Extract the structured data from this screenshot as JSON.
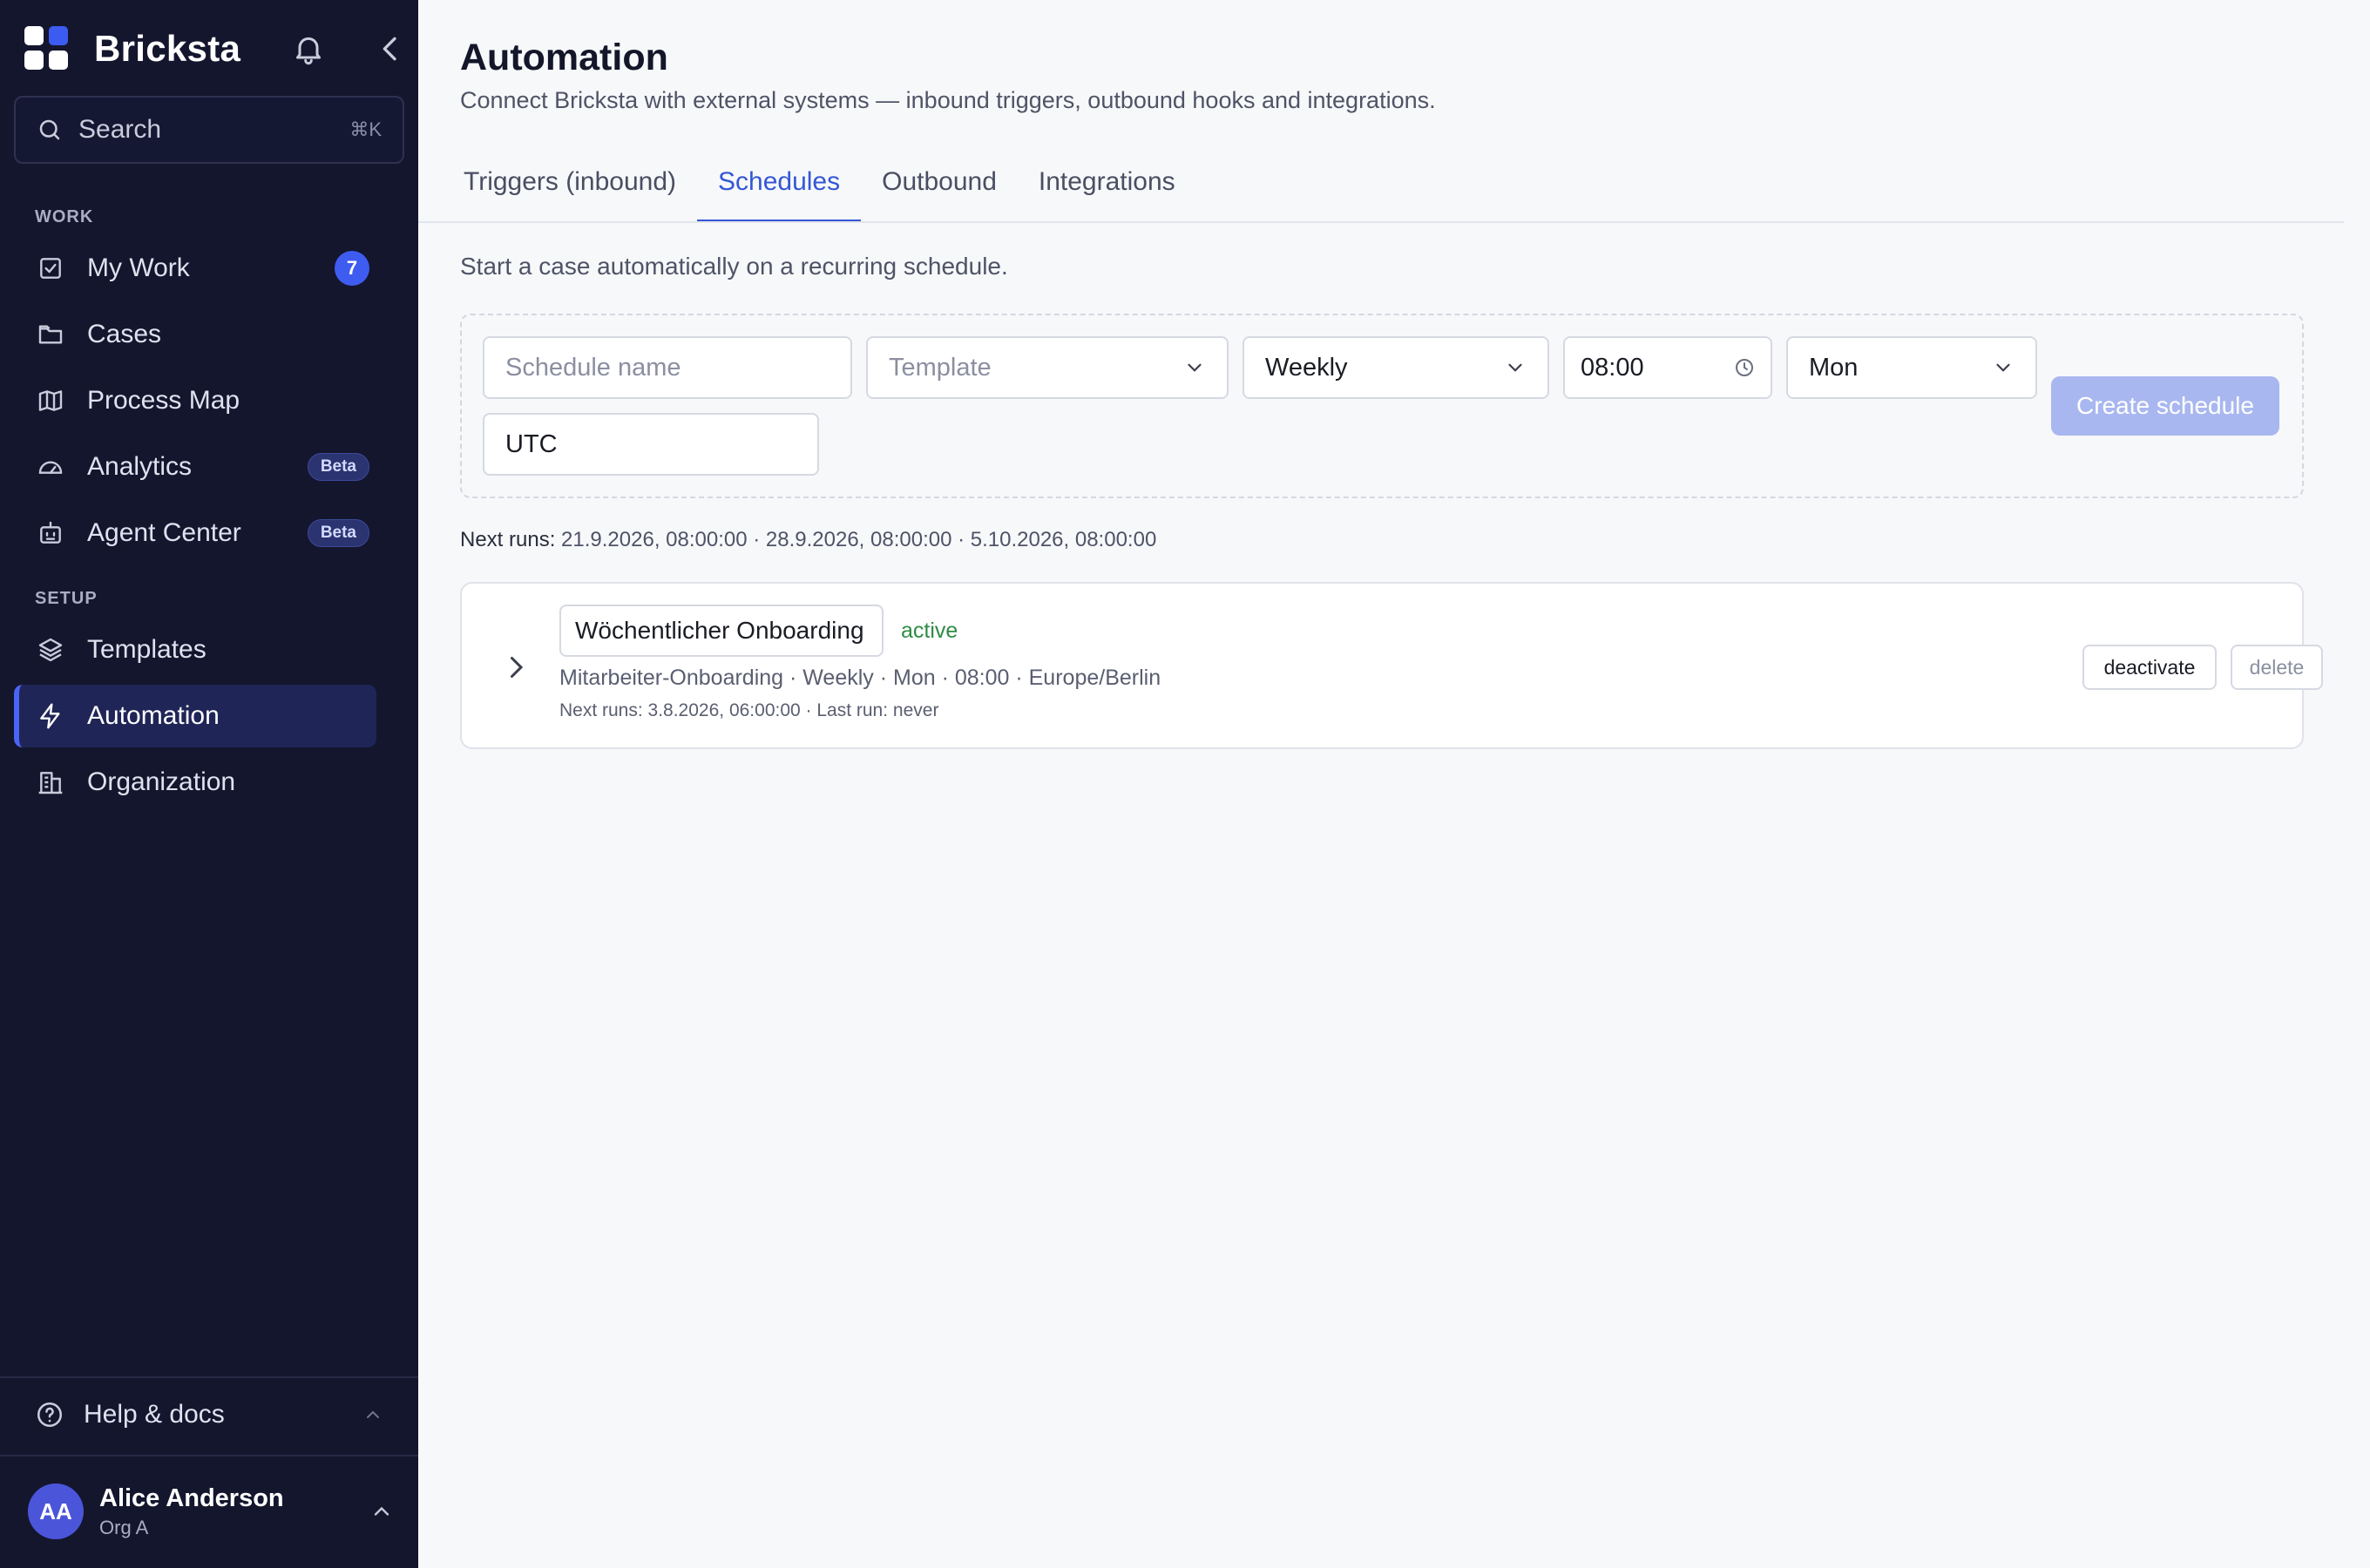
{
  "app": {
    "name": "Bricksta"
  },
  "sidebar": {
    "search": {
      "label": "Search",
      "shortcut": "⌘K"
    },
    "sections": {
      "work": "WORK",
      "setup": "SETUP"
    },
    "work_items": [
      {
        "label": "My Work",
        "icon": "checkbox-icon",
        "badge": "7"
      },
      {
        "label": "Cases",
        "icon": "folder-icon"
      },
      {
        "label": "Process Map",
        "icon": "map-icon"
      },
      {
        "label": "Analytics",
        "icon": "gauge-icon",
        "tag": "Beta"
      },
      {
        "label": "Agent Center",
        "icon": "robot-icon",
        "tag": "Beta"
      }
    ],
    "setup_items": [
      {
        "label": "Templates",
        "icon": "layers-icon"
      },
      {
        "label": "Automation",
        "icon": "lightning-icon",
        "active": true
      },
      {
        "label": "Organization",
        "icon": "building-icon"
      }
    ],
    "help": {
      "label": "Help & docs"
    },
    "user": {
      "initials": "AA",
      "name": "Alice Anderson",
      "org": "Org A"
    }
  },
  "header": {
    "title": "Automation",
    "subtitle": "Connect Bricksta with external systems — inbound triggers, outbound hooks and integrations."
  },
  "tabs": [
    {
      "label": "Triggers (inbound)"
    },
    {
      "label": "Schedules",
      "active": true
    },
    {
      "label": "Outbound"
    },
    {
      "label": "Integrations"
    }
  ],
  "schedules": {
    "intro": "Start a case automatically on a recurring schedule.",
    "form": {
      "name_placeholder": "Schedule name",
      "template_placeholder": "Template",
      "frequency": "Weekly",
      "time": "08:00",
      "weekday": "Mon",
      "timezone": "UTC",
      "create_label": "Create schedule"
    },
    "next_runs_label": "Next runs:",
    "next_runs": "21.9.2026, 08:00:00 · 28.9.2026, 08:00:00 · 5.10.2026, 08:00:00",
    "items": [
      {
        "name": "Wöchentlicher Onboarding",
        "status": "active",
        "meta": "Mitarbeiter-Onboarding · Weekly · Mon · 08:00 · Europe/Berlin",
        "runs": "Next runs: 3.8.2026, 06:00:00 · Last run: never",
        "deactivate_label": "deactivate",
        "delete_label": "delete"
      }
    ]
  },
  "colors": {
    "sidebar_bg": "#14162e",
    "accent": "#3457d5",
    "active_status": "#2e8b45",
    "create_button": "#a9b7f0"
  }
}
